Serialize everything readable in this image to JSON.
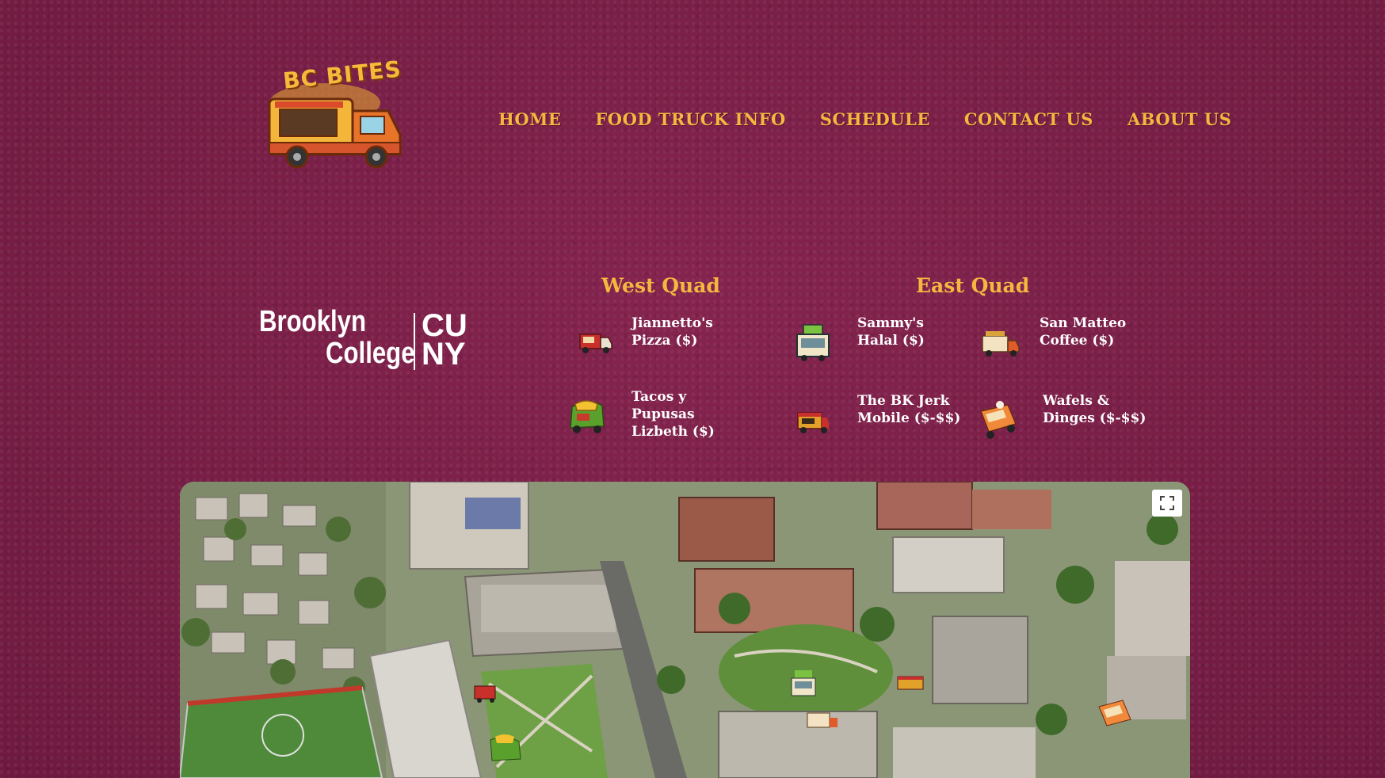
{
  "header": {
    "logo_text": "BC BITES",
    "nav": [
      {
        "label": "HOME"
      },
      {
        "label": "FOOD TRUCK INFO"
      },
      {
        "label": "SCHEDULE"
      },
      {
        "label": "CONTACT US"
      },
      {
        "label": "ABOUT US"
      }
    ]
  },
  "college_logo": {
    "line1": "Brooklyn",
    "line2": "College",
    "cuny_top": "CU",
    "cuny_bottom": "NY"
  },
  "quads": {
    "west": {
      "title": "West Quad",
      "trucks": [
        {
          "label": "Jiannetto's Pizza ($)",
          "icon": "pizza-truck-icon"
        },
        {
          "label": "Tacos y Pupusas Lizbeth ($)",
          "icon": "taco-truck-icon"
        }
      ]
    },
    "east": {
      "title": "East Quad",
      "trucks": [
        {
          "label": "Sammy's Halal ($)",
          "icon": "halal-truck-icon"
        },
        {
          "label": "San Matteo Coffee ($)",
          "icon": "coffee-truck-icon"
        },
        {
          "label": "The BK Jerk Mobile ($-$$)",
          "icon": "jerk-truck-icon"
        },
        {
          "label": "Wafels & Dinges ($-$$)",
          "icon": "wafel-truck-icon"
        }
      ]
    }
  },
  "map": {
    "fullscreen_icon": "fullscreen-icon"
  },
  "colors": {
    "background": "#7a1f47",
    "accent": "#f4b840",
    "text": "#ffffff"
  }
}
